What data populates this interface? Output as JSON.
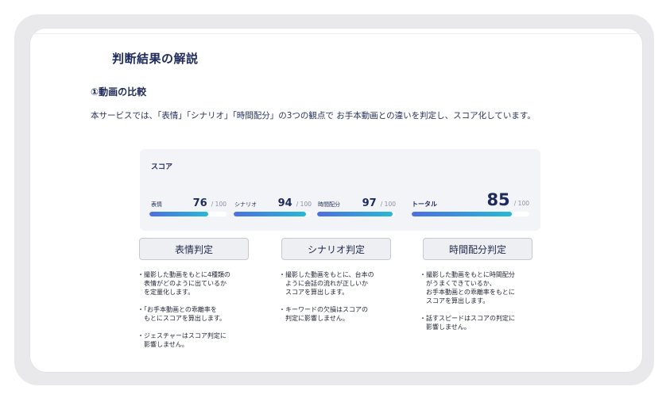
{
  "title": "判断結果の解説",
  "section": {
    "heading": "①動画の比較"
  },
  "description": "本サービスでは、「表情」「シナリオ」「時間配分」の3つの観点で お手本動画との違いを判定し、スコア化しています。",
  "score": {
    "heading": "スコア",
    "metrics": [
      {
        "label": "表情",
        "value": "76",
        "max": "/ 100",
        "fraction": 0.76
      },
      {
        "label": "シナリオ",
        "value": "94",
        "max": "/ 100",
        "fraction": 0.94
      },
      {
        "label": "時間配分",
        "value": "97",
        "max": "/ 100",
        "fraction": 0.97
      }
    ],
    "total": {
      "label": "トータル",
      "value": "85",
      "max": "/ 100",
      "fraction": 0.85
    }
  },
  "colors": {
    "bar_start": "#4c6fe0",
    "bar_end": "#27b8d6",
    "text": "#1e2a5c"
  },
  "judgements": [
    {
      "button": "表情判定",
      "notes": [
        "・撮影した動画をもとに4種類の\n表情がどのように出ているか\nを定量化します。",
        "・「お手本動画との乖離率を\nもとにスコアを算出します。",
        "・ジェスチャーはスコア判定に\n影響しません。"
      ]
    },
    {
      "button": "シナリオ判定",
      "notes": [
        "・撮影した動画をもとに、台本の\nように会話の流れが正しいか\nスコアを算出します。",
        "・キーワードの欠損はスコアの\n判定に影響しません。"
      ]
    },
    {
      "button": "時間配分判定",
      "notes": [
        "・撮影した動画をもとに時間配分\nがうまくできているか、\nお手本動画との乖離率をもとに\nスコアを算出します。",
        "・話すスピードはスコアの判定に\n影響しません。"
      ]
    }
  ]
}
